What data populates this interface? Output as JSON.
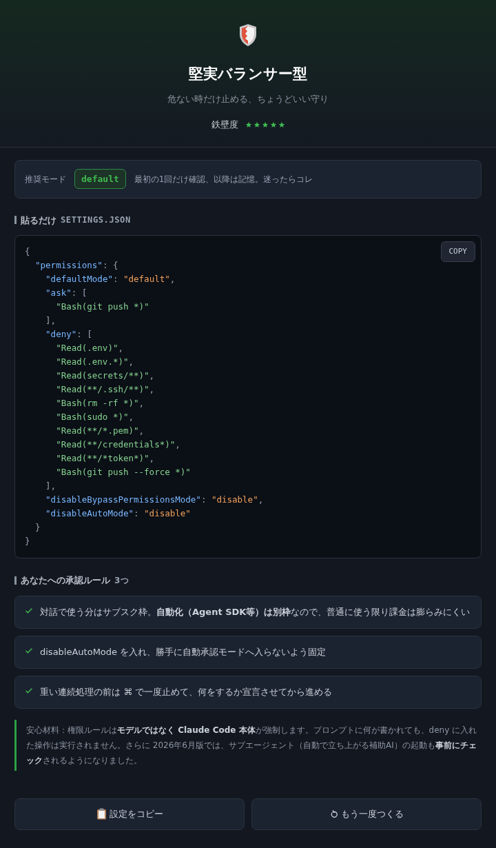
{
  "header": {
    "title": "堅実バランサー型",
    "subtitle": "危ない時だけ止める、ちょうどいい守り",
    "rating": {
      "label": "鉄壁度",
      "stars": 5
    }
  },
  "mode": {
    "label": "推奨モード",
    "value": "default",
    "description": "最初の1回だけ確認、以降は記憶。迷ったらコレ"
  },
  "settings": {
    "heading": "貼るだけ",
    "file": "SETTINGS.JSON",
    "copy_button": "COPY",
    "code_lines": [
      {
        "tokens": [
          {
            "kind": "punct",
            "text": "{"
          }
        ],
        "children": [
          {
            "tokens": [
              {
                "kind": "key",
                "text": "\"permissions\""
              },
              {
                "kind": "punct",
                "text": ": {"
              }
            ],
            "children": [
              {
                "tokens": [
                  {
                    "kind": "key",
                    "text": "\"defaultMode\""
                  },
                  {
                    "kind": "punct",
                    "text": ": "
                  },
                  {
                    "kind": "value",
                    "text": "\"default\""
                  },
                  {
                    "kind": "punct",
                    "text": ","
                  }
                ]
              },
              {
                "tokens": [
                  {
                    "kind": "key",
                    "text": "\"ask\""
                  },
                  {
                    "kind": "punct",
                    "text": ": ["
                  }
                ],
                "children": [
                  {
                    "tokens": [
                      {
                        "kind": "string",
                        "text": "\"Bash(git push *)\""
                      }
                    ]
                  }
                ]
              },
              {
                "tokens": [
                  {
                    "kind": "punct",
                    "text": "],"
                  }
                ]
              },
              {
                "tokens": [
                  {
                    "kind": "key",
                    "text": "\"deny\""
                  },
                  {
                    "kind": "punct",
                    "text": ": ["
                  }
                ],
                "children": [
                  {
                    "tokens": [
                      {
                        "kind": "string",
                        "text": "\"Read(.env)\""
                      },
                      {
                        "kind": "punct",
                        "text": ","
                      }
                    ]
                  },
                  {
                    "tokens": [
                      {
                        "kind": "string",
                        "text": "\"Read(.env.*)\""
                      },
                      {
                        "kind": "punct",
                        "text": ","
                      }
                    ]
                  },
                  {
                    "tokens": [
                      {
                        "kind": "string",
                        "text": "\"Read(secrets/**)\""
                      },
                      {
                        "kind": "punct",
                        "text": ","
                      }
                    ]
                  },
                  {
                    "tokens": [
                      {
                        "kind": "string",
                        "text": "\"Read(**/.ssh/**)\""
                      },
                      {
                        "kind": "punct",
                        "text": ","
                      }
                    ]
                  },
                  {
                    "tokens": [
                      {
                        "kind": "string",
                        "text": "\"Bash(rm -rf *)\""
                      },
                      {
                        "kind": "punct",
                        "text": ","
                      }
                    ]
                  },
                  {
                    "tokens": [
                      {
                        "kind": "string",
                        "text": "\"Bash(sudo *)\""
                      },
                      {
                        "kind": "punct",
                        "text": ","
                      }
                    ]
                  },
                  {
                    "tokens": [
                      {
                        "kind": "string",
                        "text": "\"Read(**/*.pem)\""
                      },
                      {
                        "kind": "punct",
                        "text": ","
                      }
                    ]
                  },
                  {
                    "tokens": [
                      {
                        "kind": "string",
                        "text": "\"Read(**/credentials*)\""
                      },
                      {
                        "kind": "punct",
                        "text": ","
                      }
                    ]
                  },
                  {
                    "tokens": [
                      {
                        "kind": "string",
                        "text": "\"Read(**/*token*)\""
                      },
                      {
                        "kind": "punct",
                        "text": ","
                      }
                    ]
                  },
                  {
                    "tokens": [
                      {
                        "kind": "string",
                        "text": "\"Bash(git push --force *)\""
                      }
                    ]
                  }
                ]
              },
              {
                "tokens": [
                  {
                    "kind": "punct",
                    "text": "],"
                  }
                ]
              },
              {
                "tokens": [
                  {
                    "kind": "key",
                    "text": "\"disableBypassPermissionsMode\""
                  },
                  {
                    "kind": "punct",
                    "text": ": "
                  },
                  {
                    "kind": "value",
                    "text": "\"disable\""
                  },
                  {
                    "kind": "punct",
                    "text": ","
                  }
                ]
              },
              {
                "tokens": [
                  {
                    "kind": "key",
                    "text": "\"disableAutoMode\""
                  },
                  {
                    "kind": "punct",
                    "text": ": "
                  },
                  {
                    "kind": "value",
                    "text": "\"disable\""
                  }
                ]
              }
            ]
          },
          {
            "tokens": [
              {
                "kind": "punct",
                "text": "}"
              }
            ]
          }
        ]
      },
      {
        "tokens": [
          {
            "kind": "punct",
            "text": "}"
          }
        ]
      }
    ]
  },
  "rules": {
    "heading": "あなたへの承認ルール",
    "count": "3つ",
    "items": [
      {
        "text": "対話で使う分はサブスク枠。**自動化（Agent SDK等）は別枠**なので、普通に使う限り課金は膨らみにくい"
      },
      {
        "text": "disableAutoMode を入れ、勝手に自動承認モードへ入らないよう固定"
      },
      {
        "text": "重い連続処理の前は ⌘ で一度止めて、何をするか宣言させてから進める"
      }
    ]
  },
  "note": "安心材料：権限ルールは**モデルではなく Claude Code 本体**が強制します。プロンプトに何が書かれても、deny に入れた操作は実行されません。さらに 2026年6月版では、サブエージェント（自動で立ち上がる補助AI）の起動も**事前にチェック**されるようになりました。",
  "buttons": [
    {
      "kind": "copy",
      "label": "設定をコピー"
    },
    {
      "kind": "retry",
      "label": "もう一度つくる"
    }
  ]
}
